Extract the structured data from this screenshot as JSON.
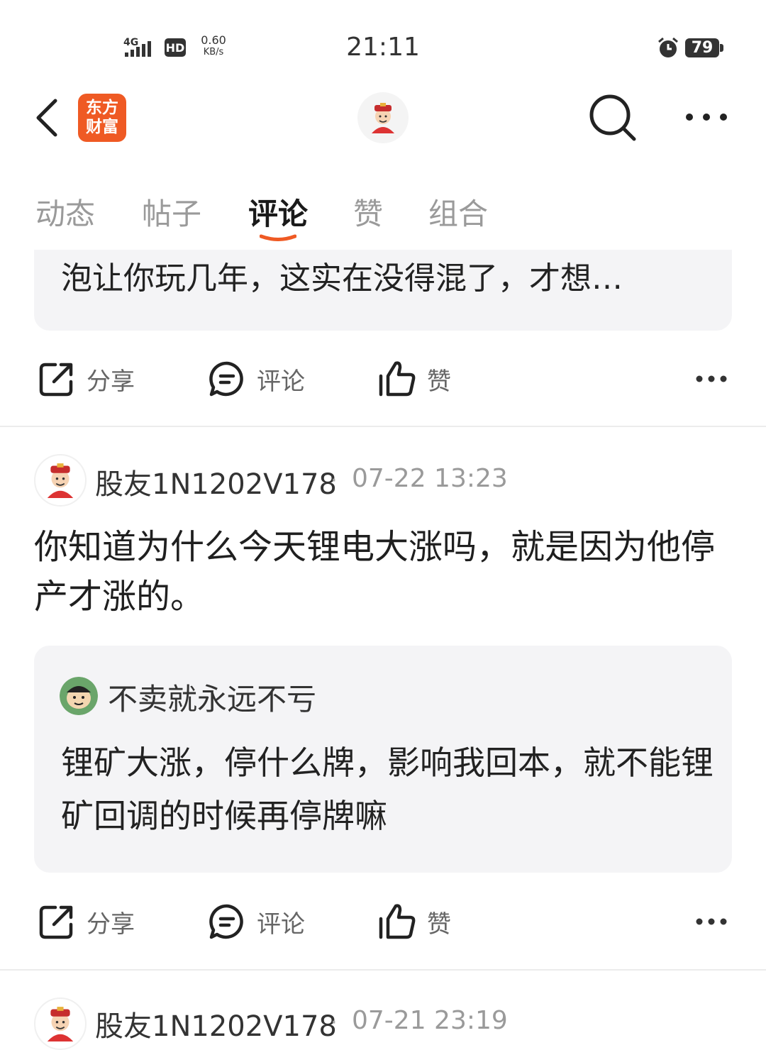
{
  "status_bar": {
    "network": "4G",
    "hd": "HD",
    "speed_value": "0.60",
    "speed_unit": "KB/s",
    "time": "21:11",
    "battery": "79"
  },
  "nav": {
    "brand_line1": "东方",
    "brand_line2": "财富"
  },
  "tabs": [
    {
      "label": "动态",
      "active": false
    },
    {
      "label": "帖子",
      "active": false
    },
    {
      "label": "评论",
      "active": true
    },
    {
      "label": "赞",
      "active": false
    },
    {
      "label": "组合",
      "active": false
    }
  ],
  "accent_color": "#ef5a24",
  "top_quote": {
    "text": "泡让你玩几年，这实在没得混了，才想…"
  },
  "actions": {
    "share": "分享",
    "comment": "评论",
    "like": "赞"
  },
  "posts": [
    {
      "username": "股友1N1202V178",
      "separator": "·",
      "time": "07-22 13:23",
      "body": "你知道为什么今天锂电大涨吗，就是因为他停产才涨的。",
      "quote": {
        "username": "不卖就永远不亏",
        "text": "锂矿大涨，停什么牌，影响我回本，就不能锂矿回调的时候再停牌嘛"
      }
    },
    {
      "username": "股友1N1202V178",
      "separator": "·",
      "time": "07-21 23:19"
    }
  ]
}
